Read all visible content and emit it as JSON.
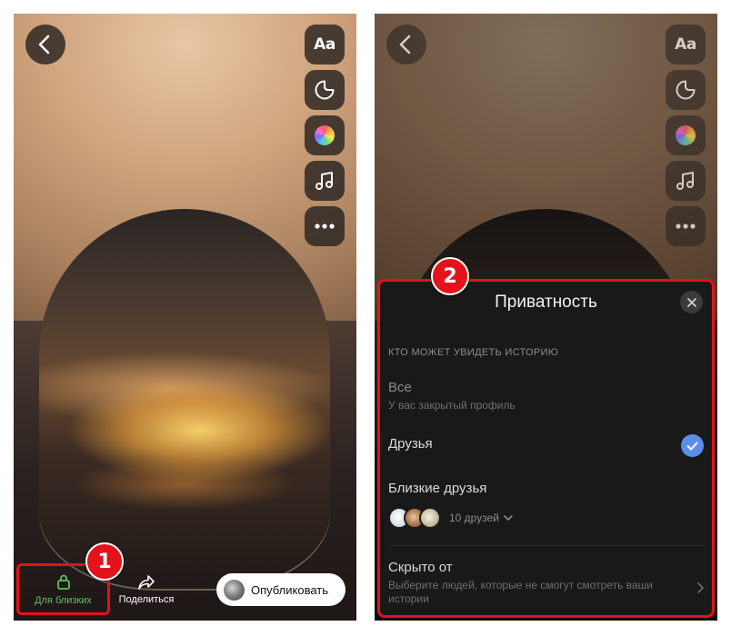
{
  "left_screen": {
    "close_friends_label": "Для близких",
    "share_label": "Поделиться",
    "publish_label": "Опубликовать",
    "step_badge": "1"
  },
  "right_screen": {
    "step_badge": "2",
    "sheet": {
      "title": "Приватность",
      "section_header": "КТО МОЖЕТ УВИДЕТЬ ИСТОРИЮ",
      "options": [
        {
          "title": "Все",
          "subtitle": "У вас закрытый профиль",
          "disabled": true
        },
        {
          "title": "Друзья",
          "selected": true
        },
        {
          "title": "Близкие друзья",
          "friends_count": "10 друзей"
        },
        {
          "title": "Скрыто от",
          "subtitle": "Выберите людей, которые не смогут смотреть ваши истории"
        }
      ]
    }
  },
  "toolbar": {
    "text_tool_label": "Aa",
    "icons": [
      "back-icon",
      "text-icon",
      "sticker-icon",
      "color-wheel-icon",
      "music-icon",
      "more-icon"
    ]
  },
  "colors": {
    "highlight_red": "#e3121b",
    "close_friends_green": "#59c265",
    "check_blue": "#5b8ee6",
    "sheet_background": "#19191a"
  }
}
